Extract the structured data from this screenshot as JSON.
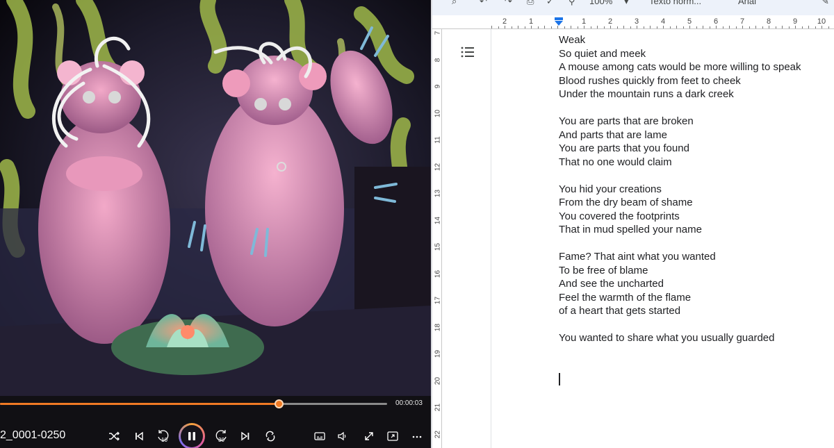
{
  "player": {
    "file_title": "2_0001-0250",
    "current_time": "00:00:03",
    "progress_fraction": 0.72,
    "accent_color": "#f07a24",
    "buttons": [
      {
        "name": "shuffle-icon"
      },
      {
        "name": "previous-track-icon"
      },
      {
        "name": "rewind-10-icon",
        "label": "10"
      },
      {
        "name": "pause-icon"
      },
      {
        "name": "forward-30-icon",
        "label": "30"
      },
      {
        "name": "next-track-icon"
      },
      {
        "name": "repeat-icon"
      },
      {
        "name": "captions-icon"
      },
      {
        "name": "volume-icon"
      },
      {
        "name": "fullscreen-icon"
      },
      {
        "name": "mini-player-icon"
      },
      {
        "name": "more-options-icon"
      }
    ]
  },
  "editor": {
    "toolbar": {
      "zoom": "100%",
      "style": "Texto norm...",
      "font": "Arial"
    },
    "ruler": {
      "h_numbers": [
        "2",
        "1",
        "1",
        "2",
        "3",
        "4",
        "5",
        "6",
        "7",
        "8",
        "9",
        "10"
      ],
      "v_numbers": [
        "7",
        "8",
        "9",
        "10",
        "11",
        "12",
        "13",
        "14",
        "15",
        "16",
        "17",
        "18",
        "19",
        "20",
        "21",
        "22"
      ]
    },
    "lines": [
      "Weak",
      "So quiet and meek",
      "A mouse among cats would be more willing to speak",
      "Blood rushes quickly from feet to cheek",
      "Under the mountain runs a dark creek",
      "",
      "You are parts that are broken",
      "And parts that are lame",
      "You are parts that you found",
      "That no one would claim",
      "",
      "You hid your creations",
      "From the dry beam of shame",
      "You covered the footprints",
      "That in mud spelled your name",
      "",
      "Fame? That aint what you wanted",
      "To be free of blame",
      "And see the uncharted",
      "Feel the warmth of the flame",
      "of a heart that gets started",
      "",
      "You wanted to share what you usually guarded"
    ]
  }
}
